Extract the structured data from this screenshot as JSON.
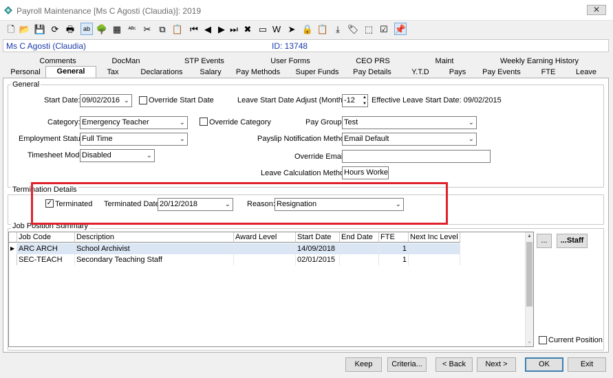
{
  "window": {
    "title": "Payroll Maintenance  [Ms C Agosti (Claudia)]: 2019",
    "close_glyph": "✕"
  },
  "toolbar": {
    "icons": [
      "new-icon",
      "open-icon",
      "save-icon",
      "refresh-icon",
      "print-icon",
      "field-icon",
      "tree-icon",
      "calculator-icon",
      "spellcheck-icon",
      "cut-icon",
      "copy-icon",
      "paste-icon",
      "first-icon",
      "prev-icon",
      "next-icon",
      "last-icon",
      "delete-icon",
      "card-icon",
      "word-icon",
      "pin-icon",
      "lock-icon",
      "clipboard-icon",
      "export-icon",
      "tag-icon",
      "select-icon",
      "clipboard-check-icon",
      "pushpin-icon"
    ],
    "glyphs": [
      "🗋",
      "📂",
      "💾",
      "⟳",
      "🖶",
      "ab",
      "🌳",
      "▦",
      "ᴬᴮᶜ",
      "✂",
      "⧉",
      "📋",
      "⏮",
      "◀",
      "▶",
      "⏭",
      "✖",
      "▭",
      "W",
      "➤",
      "🔒",
      "📋",
      "⤓",
      "🏷",
      "⬚",
      "☑",
      "📌"
    ]
  },
  "employee": {
    "name": "Ms C Agosti (Claudia)",
    "id_label": "ID: 13748"
  },
  "tabs_row1": [
    "Comments",
    "DocMan",
    "STP Events",
    "User Forms",
    "CEO PRS",
    "Maint",
    "Weekly Earning History"
  ],
  "tabs_row2": [
    "Personal",
    "General",
    "Tax",
    "Declarations",
    "Salary",
    "Pay Methods",
    "Super Funds",
    "Pay Details",
    "Y.T.D",
    "Pays",
    "Pay Events",
    "FTE",
    "Leave"
  ],
  "general": {
    "section_label": "General",
    "start_date_label": "Start Date:",
    "start_date": "09/02/2016",
    "override_start_label": "Override Start Date",
    "leave_adjust_label": "Leave Start Date Adjust (Months):",
    "leave_adjust_value": "-12",
    "effective_leave_label": "Effective Leave Start Date: 09/02/2015",
    "category_label": "Category:",
    "category_value": "Emergency Teacher",
    "override_category_label": "Override Category",
    "pay_group_label": "Pay Group:",
    "pay_group_value": "Test",
    "employment_status_label": "Employment Status:",
    "employment_status_value": "Full Time",
    "payslip_method_label": "Payslip Notification Method:",
    "payslip_method_value": "Email Default",
    "override_email_label": "Override Email:",
    "override_email_value": "",
    "timesheet_label": "Timesheet Mode:",
    "timesheet_value": "Disabled",
    "leave_calc_label": "Leave Calculation Method:",
    "leave_calc_value": "Hours Worked"
  },
  "termination": {
    "section_label": "Termination Details",
    "terminated_label": "Terminated",
    "terminated_checked": true,
    "terminated_date_label": "Terminated Date:",
    "terminated_date": "20/12/2018",
    "reason_label": "Reason:",
    "reason_value": "Resignation"
  },
  "jobs": {
    "section_label": "Job Position Summary",
    "columns": [
      "Job Code",
      "Description",
      "Award Level",
      "Start Date",
      "End Date",
      "FTE",
      "Next Inc Level"
    ],
    "rows": [
      [
        "ARC ARCH",
        "School Archivist",
        "",
        "14/09/2018",
        "",
        "1",
        ""
      ],
      [
        "SEC-TEACH",
        "Secondary Teaching Staff",
        "",
        "02/01/2015",
        "",
        "1",
        ""
      ]
    ],
    "ellipsis_button": "...",
    "staff_button": "...Staff",
    "current_position_label": "Current Position"
  },
  "footer": {
    "keep": "Keep",
    "criteria": "Criteria...",
    "back": "< Back",
    "next": "Next >",
    "ok": "OK",
    "exit": "Exit"
  },
  "glyphs": {
    "chevron": "⌄",
    "check": "✓",
    "row_pointer": "▶",
    "spin_up": "▲",
    "spin_down": "▼"
  },
  "colors": {
    "accent": "#1c3aa9",
    "highlight": "#e0202a",
    "selected_row": "#dbe6f4"
  }
}
